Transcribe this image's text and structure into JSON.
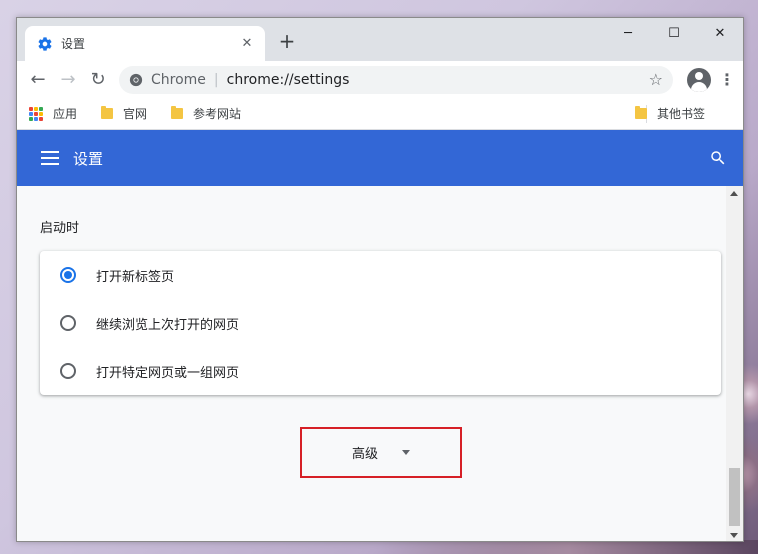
{
  "window": {
    "controls": [
      "─",
      "☐",
      "✕"
    ]
  },
  "tab": {
    "title": "设置",
    "close": "✕",
    "new_tab": "+"
  },
  "toolbar": {
    "back": "←",
    "forward": "→",
    "reload": "↻",
    "omnibox_origin": "Chrome",
    "omnibox_path": "chrome://settings",
    "star": "☆",
    "menu": "⋮"
  },
  "bookmarks": {
    "items": [
      {
        "label": "应用",
        "icon": "apps-grid-icon"
      },
      {
        "label": "官网",
        "icon": "folder-icon"
      },
      {
        "label": "参考网站",
        "icon": "folder-icon"
      }
    ],
    "other": {
      "label": "其他书签",
      "icon": "folder-icon"
    }
  },
  "settings": {
    "header_title": "设置",
    "section_title": "启动时",
    "startup_options": [
      {
        "label": "打开新标签页",
        "checked": true
      },
      {
        "label": "继续浏览上次打开的网页",
        "checked": false
      },
      {
        "label": "打开特定网页或一组网页",
        "checked": false
      }
    ],
    "advanced_label": "高级"
  },
  "colors": {
    "header_blue": "#3367d6",
    "radio_blue": "#1a73e8",
    "highlight_red": "#d61f26"
  }
}
